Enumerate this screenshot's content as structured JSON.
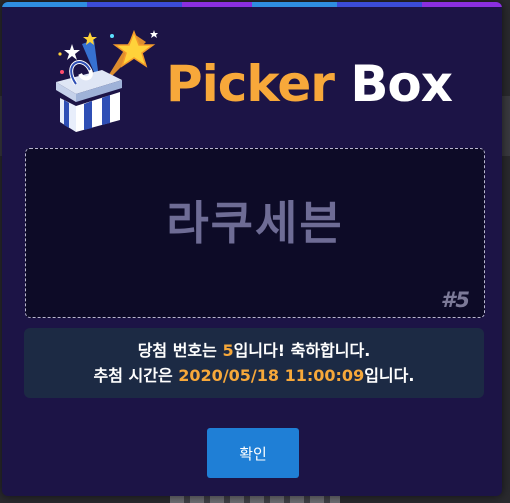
{
  "modal": {
    "title_part1": "Picker",
    "title_part2": " Box",
    "logo_icon": "gift-box-stars-icon",
    "colors": {
      "accent": "#f7a83a",
      "background": "#1c1446",
      "button": "#1f7fd6"
    }
  },
  "result": {
    "name": "라쿠세븐",
    "number": "#5"
  },
  "info": {
    "line1_prefix": "당첨 번호는 ",
    "line1_number": "5",
    "line1_suffix": "입니다! 축하합니다.",
    "line2_prefix": "추첨 시간은 ",
    "line2_time": "2020/05/18 11:00:09",
    "line2_suffix": "입니다."
  },
  "confirm_button": {
    "label": "확인"
  }
}
